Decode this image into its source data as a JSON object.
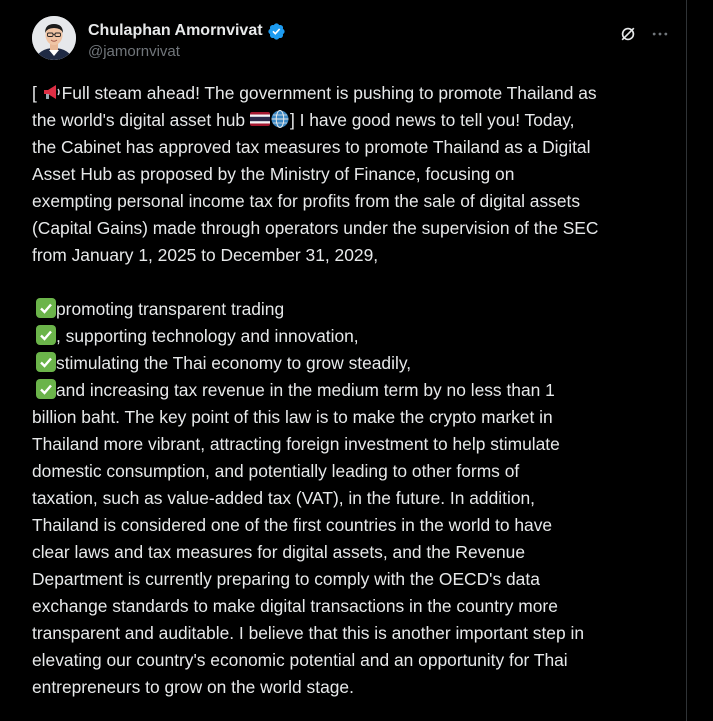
{
  "author": {
    "display_name": "Chulaphan Amornvivat",
    "handle": "@jamornvivat",
    "verified": true
  },
  "icons": {
    "grok": "grok-icon",
    "more": "more-icon",
    "verified": "verified-badge-icon"
  },
  "colors": {
    "background": "#000000",
    "text": "#e7e9ea",
    "secondary": "#71767b",
    "verified": "#1d9bf0",
    "check": "#6bb44a"
  },
  "post": {
    "lines": [
      "[ ",
      "Full steam ahead! The government is pushing to promote Thailand as",
      "the world's digital asset hub ",
      "] I have good news to tell you! Today,",
      "the Cabinet has approved tax measures to promote Thailand as a Digital",
      "Asset Hub as proposed by the Ministry of Finance, focusing on",
      "exempting personal income tax for profits from the sale of digital assets",
      "(Capital Gains) made through operators under the supervision of the SEC",
      "from January 1, 2025 to December 31, 2029,",
      "promoting transparent trading",
      ", supporting technology and innovation,",
      "stimulating the Thai economy to grow steadily,",
      "and increasing tax revenue in the medium term by no less than 1",
      "billion baht. The key point of this law is to make the crypto market in",
      "Thailand more vibrant, attracting foreign investment to help stimulate",
      "domestic consumption, and potentially leading to other forms of",
      "taxation, such as value-added tax (VAT), in the future. In addition,",
      "Thailand is considered one of the first countries in the world to have",
      "clear laws and tax measures for digital assets, and the Revenue",
      "Department is currently preparing to comply with the OECD's data",
      "exchange standards to make digital transactions in the country more",
      "transparent and auditable. I believe that this is another important step in",
      "elevating our country's economic potential and an opportunity for Thai",
      "entrepreneurs to grow on the world stage."
    ]
  }
}
